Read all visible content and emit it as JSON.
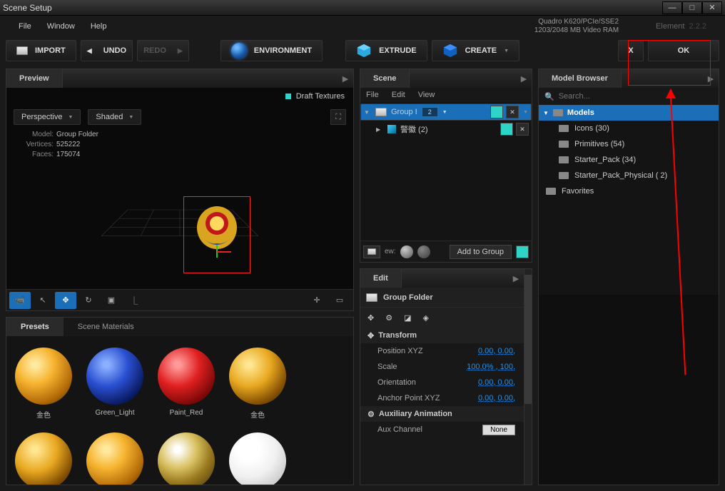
{
  "title": "Scene Setup",
  "menubar": {
    "file": "File",
    "window": "Window",
    "help": "Help"
  },
  "gpu": {
    "name": "Quadro K620/PCIe/SSE2",
    "ram": "1203/2048 MB Video RAM"
  },
  "element": {
    "label": "Element",
    "ver": "2.2.2"
  },
  "toolbar": {
    "import": "IMPORT",
    "undo": "UNDO",
    "redo": "REDO",
    "environment": "ENVIRONMENT",
    "extrude": "EXTRUDE",
    "create": "CREATE",
    "x": "X",
    "ok": "OK"
  },
  "preview": {
    "tab": "Preview",
    "draft": "Draft Textures",
    "view_mode": "Perspective",
    "shade_mode": "Shaded",
    "info": {
      "model_lbl": "Model:",
      "model": "Group Folder",
      "vert_lbl": "Vertices:",
      "vert": "525222",
      "face_lbl": "Faces:",
      "face": "175074"
    },
    "tabs": {
      "presets": "Presets",
      "materials": "Scene Materials"
    },
    "presets": [
      {
        "name": "金色",
        "cls": "gold"
      },
      {
        "name": "Green_Light",
        "cls": "blue"
      },
      {
        "name": "Paint_Red",
        "cls": "red"
      },
      {
        "name": "金色",
        "cls": "gold2"
      },
      {
        "name": "",
        "cls": "gold2"
      },
      {
        "name": "",
        "cls": "gold"
      },
      {
        "name": "",
        "cls": "chrome"
      },
      {
        "name": "",
        "cls": "white"
      }
    ]
  },
  "scene": {
    "tab": "Scene",
    "menu": {
      "file": "File",
      "edit": "Edit",
      "view": "View"
    },
    "group": {
      "name": "Group I",
      "count": "2",
      "item": "警徽 (2)"
    },
    "new_label": "ew:",
    "add_group": "Add to Group"
  },
  "edit": {
    "tab": "Edit",
    "title": "Group Folder",
    "transform": {
      "head": "Transform",
      "pos_lbl": "Position XYZ",
      "pos": "0.00,  0.00,",
      "scale_lbl": "Scale",
      "scale": "100.0% , 100.",
      "orient_lbl": "Orientation",
      "orient": "0.00,  0.00,",
      "anchor_lbl": "Anchor Point XYZ",
      "anchor": "0.00,  0.00,"
    },
    "aux": {
      "head": "Auxiliary Animation",
      "channel_lbl": "Aux Channel",
      "channel": "None"
    }
  },
  "browser": {
    "tab": "Model Browser",
    "search_ph": "Search...",
    "models": "Models",
    "items": [
      {
        "name": "Icons (30)"
      },
      {
        "name": "Primitives (54)"
      },
      {
        "name": "Starter_Pack (34)"
      },
      {
        "name": "Starter_Pack_Physical (   2)"
      }
    ],
    "favorites": "Favorites"
  }
}
